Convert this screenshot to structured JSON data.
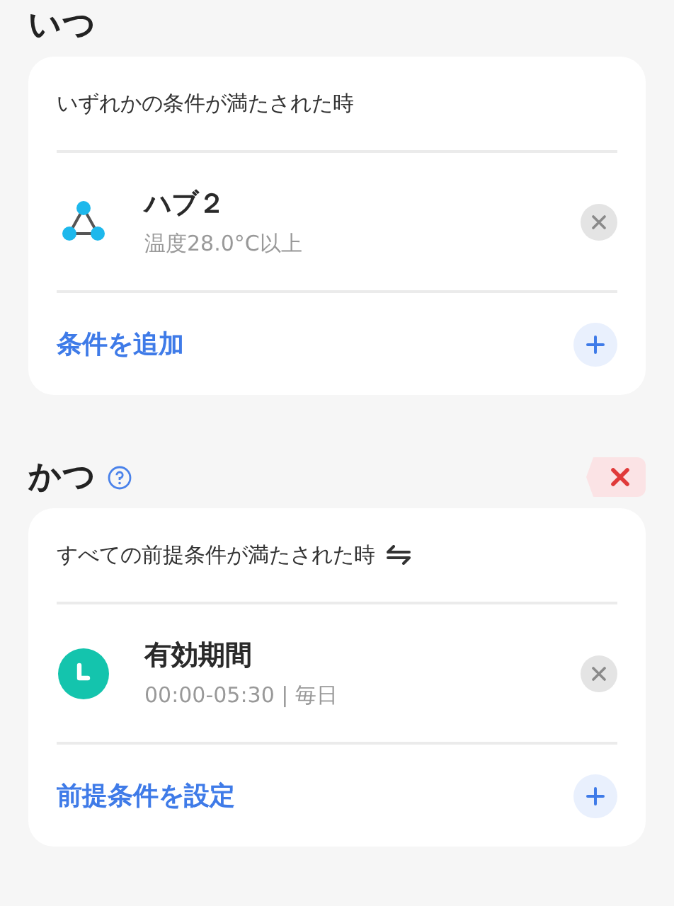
{
  "sections": [
    {
      "title": "いつ",
      "help": false,
      "removable": false,
      "header": "いずれかの条件が満たされた時",
      "switchable": false,
      "items": [
        {
          "kind": "hub",
          "name": "ハブ２",
          "detail": "温度28.0°C以上"
        }
      ],
      "add_label": "条件を追加"
    },
    {
      "title": "かつ",
      "help": true,
      "removable": true,
      "header": "すべての前提条件が満たされた時",
      "switchable": true,
      "items": [
        {
          "kind": "schedule",
          "name": "有効期間",
          "detail": "00:00-05:30 | 毎日"
        }
      ],
      "add_label": "前提条件を設定"
    }
  ]
}
